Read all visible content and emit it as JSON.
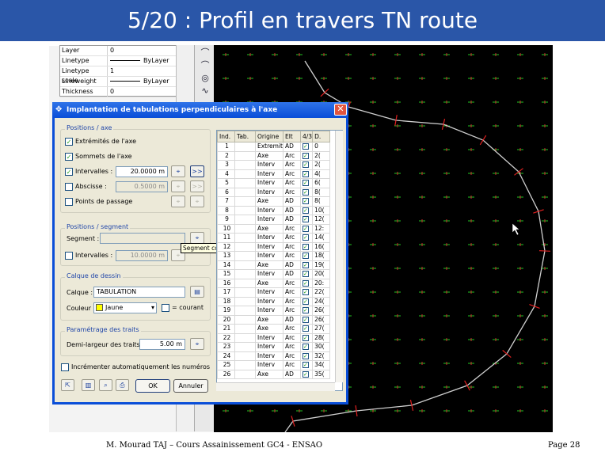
{
  "slide": {
    "title": "5/20 : Profil en travers TN route",
    "footer_left": "M. Mourad TAJ – Cours Assainissement GC4 - ENSAO",
    "footer_right": "Page   28"
  },
  "properties": [
    {
      "key": "Layer",
      "value": "0",
      "line": false
    },
    {
      "key": "Linetype",
      "value": "ByLayer",
      "line": true
    },
    {
      "key": "Linetype scale",
      "value": "1",
      "line": false
    },
    {
      "key": "Lineweight",
      "value": "ByLayer",
      "line": true
    },
    {
      "key": "Thickness",
      "value": "0",
      "line": false
    }
  ],
  "dialog": {
    "title": "Implantation de tabulations perpendiculaires à l'axe",
    "close": "✕",
    "axe_group": "Positions / axe",
    "extremites": "Extrémités de l'axe",
    "sommets": "Sommets de l'axe",
    "intervalles": "Intervalles :",
    "intervalles_value": "20.0000 m",
    "abscisse": "Abscisse :",
    "abscisse_value": "0.5000 m",
    "points_passage": "Points de passage",
    "segment_group": "Positions / segment",
    "segment": "Segment :",
    "seg_intervalles": "Intervalles :",
    "seg_intervalles_value": "10.0000 m",
    "calque_group": "Calque de dessin",
    "calque": "Calque :",
    "calque_value": "TABULATION",
    "couleur": "Couleur :",
    "couleur_value": "Jaune",
    "courant": "= courant",
    "traits_group": "Paramétrage des traits",
    "demi_largeur": "Demi-largeur des traits",
    "demi_largeur_value": "5.00 m",
    "incrementer": "Incrémenter automatiquement les numéros",
    "ok": "OK",
    "annuler": "Annuler",
    "forward": ">>",
    "tooltip": "Segment courant"
  },
  "table": {
    "headers": [
      "Ind.",
      "Tab.",
      "Origine",
      "Elt",
      "4/3",
      "D."
    ],
    "rows": [
      [
        "1",
        "",
        "Extremit",
        "AD",
        "✓",
        "0"
      ],
      [
        "2",
        "",
        "Axe",
        "Arc",
        "✓",
        "2("
      ],
      [
        "3",
        "",
        "Interv",
        "Arc",
        "✓",
        "2("
      ],
      [
        "4",
        "",
        "Interv",
        "Arc",
        "✓",
        "4("
      ],
      [
        "5",
        "",
        "Interv",
        "Arc",
        "✓",
        "6("
      ],
      [
        "6",
        "",
        "Interv",
        "Arc",
        "✓",
        "8("
      ],
      [
        "7",
        "",
        "Axe",
        "AD",
        "✓",
        "8("
      ],
      [
        "8",
        "",
        "Interv",
        "AD",
        "✓",
        "10("
      ],
      [
        "9",
        "",
        "Interv",
        "AD",
        "✓",
        "12("
      ],
      [
        "10",
        "",
        "Axe",
        "Arc",
        "✓",
        "12:"
      ],
      [
        "11",
        "",
        "Interv",
        "Arc",
        "✓",
        "14("
      ],
      [
        "12",
        "",
        "Interv",
        "Arc",
        "✓",
        "16("
      ],
      [
        "13",
        "",
        "Interv",
        "Arc",
        "✓",
        "18("
      ],
      [
        "14",
        "",
        "Axe",
        "AD",
        "✓",
        "19("
      ],
      [
        "15",
        "",
        "Interv",
        "AD",
        "✓",
        "20("
      ],
      [
        "16",
        "",
        "Axe",
        "Arc",
        "✓",
        "20:"
      ],
      [
        "17",
        "",
        "Interv",
        "Arc",
        "✓",
        "22("
      ],
      [
        "18",
        "",
        "Interv",
        "Arc",
        "✓",
        "24("
      ],
      [
        "19",
        "",
        "Interv",
        "Arc",
        "✓",
        "26("
      ],
      [
        "20",
        "",
        "Axe",
        "AD",
        "✓",
        "26("
      ],
      [
        "21",
        "",
        "Axe",
        "Arc",
        "✓",
        "27("
      ],
      [
        "22",
        "",
        "Interv",
        "Arc",
        "✓",
        "28("
      ],
      [
        "23",
        "",
        "Interv",
        "Arc",
        "✓",
        "30("
      ],
      [
        "24",
        "",
        "Interv",
        "Arc",
        "✓",
        "32("
      ],
      [
        "25",
        "",
        "Interv",
        "Arc",
        "✓",
        "34("
      ],
      [
        "26",
        "",
        "Axe",
        "AD",
        "✓",
        "35("
      ]
    ]
  },
  "icons": {
    "dialog_title_icon": "✥",
    "pick": "⌖",
    "layers": "▤",
    "dropdown": "▾"
  }
}
